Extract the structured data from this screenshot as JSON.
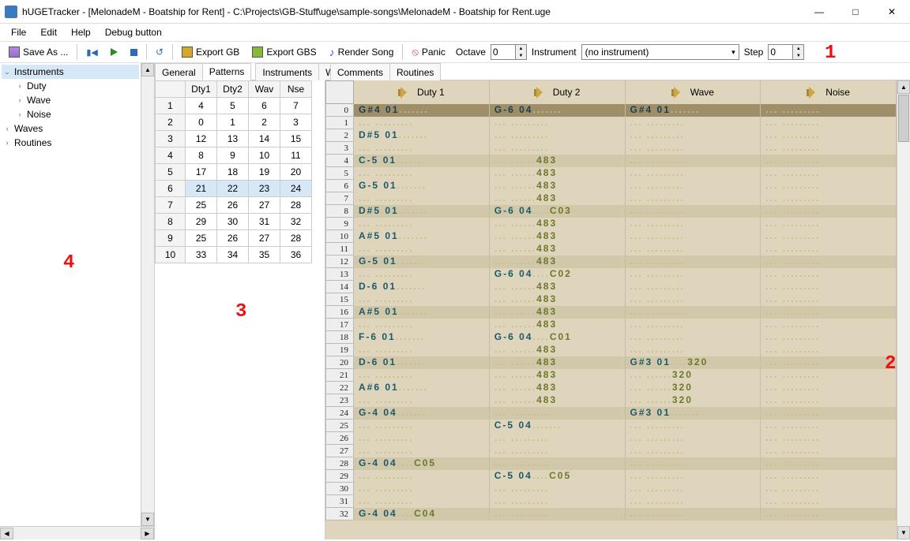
{
  "window": {
    "title": "hUGETracker - [MelonadeM - Boatship for Rent] - C:\\Projects\\GB-Stuff\\uge\\sample-songs\\MelonadeM - Boatship for Rent.uge"
  },
  "menu": {
    "file": "File",
    "edit": "Edit",
    "help": "Help",
    "debug": "Debug button"
  },
  "toolbar": {
    "saveAs": "Save As ...",
    "exportGB": "Export GB",
    "exportGBS": "Export GBS",
    "renderSong": "Render Song",
    "panic": "Panic",
    "octaveLabel": "Octave",
    "octaveVal": "0",
    "instrumentLabel": "Instrument",
    "instrumentVal": "(no instrument)",
    "stepLabel": "Step",
    "stepVal": "0"
  },
  "tree": {
    "instruments": "Instruments",
    "duty": "Duty",
    "wave": "Wave",
    "noise": "Noise",
    "waves": "Waves",
    "routines": "Routines"
  },
  "tabs1": {
    "general": "General",
    "patterns": "Patterns"
  },
  "tabs2": {
    "instruments": "Instruments",
    "waves": "Waves",
    "comments": "Comments",
    "routines": "Routines"
  },
  "orderGrid": {
    "headers": [
      "",
      "Dty1",
      "Dty2",
      "Wav",
      "Nse"
    ],
    "rows": [
      [
        "1",
        "4",
        "5",
        "6",
        "7"
      ],
      [
        "2",
        "0",
        "1",
        "2",
        "3"
      ],
      [
        "3",
        "12",
        "13",
        "14",
        "15"
      ],
      [
        "4",
        "8",
        "9",
        "10",
        "11"
      ],
      [
        "5",
        "17",
        "18",
        "19",
        "20"
      ],
      [
        "6",
        "21",
        "22",
        "23",
        "24"
      ],
      [
        "7",
        "25",
        "26",
        "27",
        "28"
      ],
      [
        "8",
        "29",
        "30",
        "31",
        "32"
      ],
      [
        "9",
        "25",
        "26",
        "27",
        "28"
      ],
      [
        "10",
        "33",
        "34",
        "35",
        "36"
      ]
    ],
    "selectedRow": 5
  },
  "tracker": {
    "channels": [
      "Duty 1",
      "Duty 2",
      "Wave",
      "Noise"
    ],
    "rows": [
      {
        "n": 0,
        "beat": true,
        "hdr": true,
        "c": [
          [
            "G#4",
            "01",
            "",
            ""
          ],
          [
            "G-6",
            "04",
            "",
            ""
          ],
          [
            "G#4",
            "01",
            "",
            ""
          ],
          [
            "",
            "",
            "",
            ""
          ]
        ]
      },
      {
        "n": 1,
        "c": [
          [
            "",
            "",
            "",
            ""
          ],
          [
            "",
            "",
            "",
            ""
          ],
          [
            "",
            "",
            "",
            ""
          ],
          [
            "",
            "",
            "",
            ""
          ]
        ]
      },
      {
        "n": 2,
        "c": [
          [
            "D#5",
            "01",
            "",
            ""
          ],
          [
            "",
            "",
            "",
            ""
          ],
          [
            "",
            "",
            "",
            ""
          ],
          [
            "",
            "",
            "",
            ""
          ]
        ]
      },
      {
        "n": 3,
        "c": [
          [
            "",
            "",
            "",
            ""
          ],
          [
            "",
            "",
            "",
            ""
          ],
          [
            "",
            "",
            "",
            ""
          ],
          [
            "",
            "",
            "",
            ""
          ]
        ]
      },
      {
        "n": 4,
        "beat": true,
        "c": [
          [
            "C-5",
            "01",
            "",
            ""
          ],
          [
            "",
            "",
            "",
            "483"
          ],
          [
            "",
            "",
            "",
            ""
          ],
          [
            "",
            "",
            "",
            ""
          ]
        ]
      },
      {
        "n": 5,
        "c": [
          [
            "",
            "",
            "",
            ""
          ],
          [
            "",
            "",
            "",
            "483"
          ],
          [
            "",
            "",
            "",
            ""
          ],
          [
            "",
            "",
            "",
            ""
          ]
        ]
      },
      {
        "n": 6,
        "c": [
          [
            "G-5",
            "01",
            "",
            ""
          ],
          [
            "",
            "",
            "",
            "483"
          ],
          [
            "",
            "",
            "",
            ""
          ],
          [
            "",
            "",
            "",
            ""
          ]
        ]
      },
      {
        "n": 7,
        "c": [
          [
            "",
            "",
            "",
            ""
          ],
          [
            "",
            "",
            "",
            "483"
          ],
          [
            "",
            "",
            "",
            ""
          ],
          [
            "",
            "",
            "",
            ""
          ]
        ]
      },
      {
        "n": 8,
        "beat": true,
        "c": [
          [
            "D#5",
            "01",
            "",
            ""
          ],
          [
            "G-6",
            "04",
            "",
            "C03"
          ],
          [
            "",
            "",
            "",
            ""
          ],
          [
            "",
            "",
            "",
            ""
          ]
        ]
      },
      {
        "n": 9,
        "c": [
          [
            "",
            "",
            "",
            ""
          ],
          [
            "",
            "",
            "",
            "483"
          ],
          [
            "",
            "",
            "",
            ""
          ],
          [
            "",
            "",
            "",
            ""
          ]
        ]
      },
      {
        "n": 10,
        "c": [
          [
            "A#5",
            "01",
            "",
            ""
          ],
          [
            "",
            "",
            "",
            "483"
          ],
          [
            "",
            "",
            "",
            ""
          ],
          [
            "",
            "",
            "",
            ""
          ]
        ]
      },
      {
        "n": 11,
        "c": [
          [
            "",
            "",
            "",
            ""
          ],
          [
            "",
            "",
            "",
            "483"
          ],
          [
            "",
            "",
            "",
            ""
          ],
          [
            "",
            "",
            "",
            ""
          ]
        ]
      },
      {
        "n": 12,
        "beat": true,
        "c": [
          [
            "G-5",
            "01",
            "",
            ""
          ],
          [
            "",
            "",
            "",
            "483"
          ],
          [
            "",
            "",
            "",
            ""
          ],
          [
            "",
            "",
            "",
            ""
          ]
        ]
      },
      {
        "n": 13,
        "c": [
          [
            "",
            "",
            "",
            ""
          ],
          [
            "G-6",
            "04",
            "",
            "C02"
          ],
          [
            "",
            "",
            "",
            ""
          ],
          [
            "",
            "",
            "",
            ""
          ]
        ]
      },
      {
        "n": 14,
        "c": [
          [
            "D-6",
            "01",
            "",
            ""
          ],
          [
            "",
            "",
            "",
            "483"
          ],
          [
            "",
            "",
            "",
            ""
          ],
          [
            "",
            "",
            "",
            ""
          ]
        ]
      },
      {
        "n": 15,
        "c": [
          [
            "",
            "",
            "",
            ""
          ],
          [
            "",
            "",
            "",
            "483"
          ],
          [
            "",
            "",
            "",
            ""
          ],
          [
            "",
            "",
            "",
            ""
          ]
        ]
      },
      {
        "n": 16,
        "beat": true,
        "c": [
          [
            "A#5",
            "01",
            "",
            ""
          ],
          [
            "",
            "",
            "",
            "483"
          ],
          [
            "",
            "",
            "",
            ""
          ],
          [
            "",
            "",
            "",
            ""
          ]
        ]
      },
      {
        "n": 17,
        "c": [
          [
            "",
            "",
            "",
            ""
          ],
          [
            "",
            "",
            "",
            "483"
          ],
          [
            "",
            "",
            "",
            ""
          ],
          [
            "",
            "",
            "",
            ""
          ]
        ]
      },
      {
        "n": 18,
        "c": [
          [
            "F-6",
            "01",
            "",
            ""
          ],
          [
            "G-6",
            "04",
            "",
            "C01"
          ],
          [
            "",
            "",
            "",
            ""
          ],
          [
            "",
            "",
            "",
            ""
          ]
        ]
      },
      {
        "n": 19,
        "c": [
          [
            "",
            "",
            "",
            ""
          ],
          [
            "",
            "",
            "",
            "483"
          ],
          [
            "",
            "",
            "",
            ""
          ],
          [
            "",
            "",
            "",
            ""
          ]
        ]
      },
      {
        "n": 20,
        "beat": true,
        "c": [
          [
            "D-6",
            "01",
            "",
            ""
          ],
          [
            "",
            "",
            "",
            "483"
          ],
          [
            "G#3",
            "01",
            "",
            "320"
          ],
          [
            "",
            "",
            "",
            ""
          ]
        ]
      },
      {
        "n": 21,
        "c": [
          [
            "",
            "",
            "",
            ""
          ],
          [
            "",
            "",
            "",
            "483"
          ],
          [
            "",
            "",
            "",
            "320"
          ],
          [
            "",
            "",
            "",
            ""
          ]
        ]
      },
      {
        "n": 22,
        "c": [
          [
            "A#6",
            "01",
            "",
            ""
          ],
          [
            "",
            "",
            "",
            "483"
          ],
          [
            "",
            "",
            "",
            "320"
          ],
          [
            "",
            "",
            "",
            ""
          ]
        ]
      },
      {
        "n": 23,
        "c": [
          [
            "",
            "",
            "",
            ""
          ],
          [
            "",
            "",
            "",
            "483"
          ],
          [
            "",
            "",
            "",
            "320"
          ],
          [
            "",
            "",
            "",
            ""
          ]
        ]
      },
      {
        "n": 24,
        "beat": true,
        "c": [
          [
            "G-4",
            "04",
            "",
            ""
          ],
          [
            "",
            "",
            "",
            ""
          ],
          [
            "G#3",
            "01",
            "",
            ""
          ],
          [
            "",
            "",
            "",
            ""
          ]
        ]
      },
      {
        "n": 25,
        "c": [
          [
            "",
            "",
            "",
            ""
          ],
          [
            "C-5",
            "04",
            "",
            ""
          ],
          [
            "",
            "",
            "",
            ""
          ],
          [
            "",
            "",
            "",
            ""
          ]
        ]
      },
      {
        "n": 26,
        "c": [
          [
            "",
            "",
            "",
            ""
          ],
          [
            "",
            "",
            "",
            ""
          ],
          [
            "",
            "",
            "",
            ""
          ],
          [
            "",
            "",
            "",
            ""
          ]
        ]
      },
      {
        "n": 27,
        "c": [
          [
            "",
            "",
            "",
            ""
          ],
          [
            "",
            "",
            "",
            ""
          ],
          [
            "",
            "",
            "",
            ""
          ],
          [
            "",
            "",
            "",
            ""
          ]
        ]
      },
      {
        "n": 28,
        "beat": true,
        "c": [
          [
            "G-4",
            "04",
            "",
            "C05"
          ],
          [
            "",
            "",
            "",
            ""
          ],
          [
            "",
            "",
            "",
            ""
          ],
          [
            "",
            "",
            "",
            ""
          ]
        ]
      },
      {
        "n": 29,
        "c": [
          [
            "",
            "",
            "",
            ""
          ],
          [
            "C-5",
            "04",
            "",
            "C05"
          ],
          [
            "",
            "",
            "",
            ""
          ],
          [
            "",
            "",
            "",
            ""
          ]
        ]
      },
      {
        "n": 30,
        "c": [
          [
            "",
            "",
            "",
            ""
          ],
          [
            "",
            "",
            "",
            ""
          ],
          [
            "",
            "",
            "",
            ""
          ],
          [
            "",
            "",
            "",
            ""
          ]
        ]
      },
      {
        "n": 31,
        "c": [
          [
            "",
            "",
            "",
            ""
          ],
          [
            "",
            "",
            "",
            ""
          ],
          [
            "",
            "",
            "",
            ""
          ],
          [
            "",
            "",
            "",
            ""
          ]
        ]
      },
      {
        "n": 32,
        "beat": true,
        "c": [
          [
            "G-4",
            "04",
            "",
            "C04"
          ],
          [
            "",
            "",
            "",
            ""
          ],
          [
            "",
            "",
            "",
            ""
          ],
          [
            "",
            "",
            "",
            ""
          ]
        ]
      }
    ]
  },
  "annotations": {
    "a1": "1",
    "a2": "2",
    "a3": "3",
    "a4": "4"
  }
}
